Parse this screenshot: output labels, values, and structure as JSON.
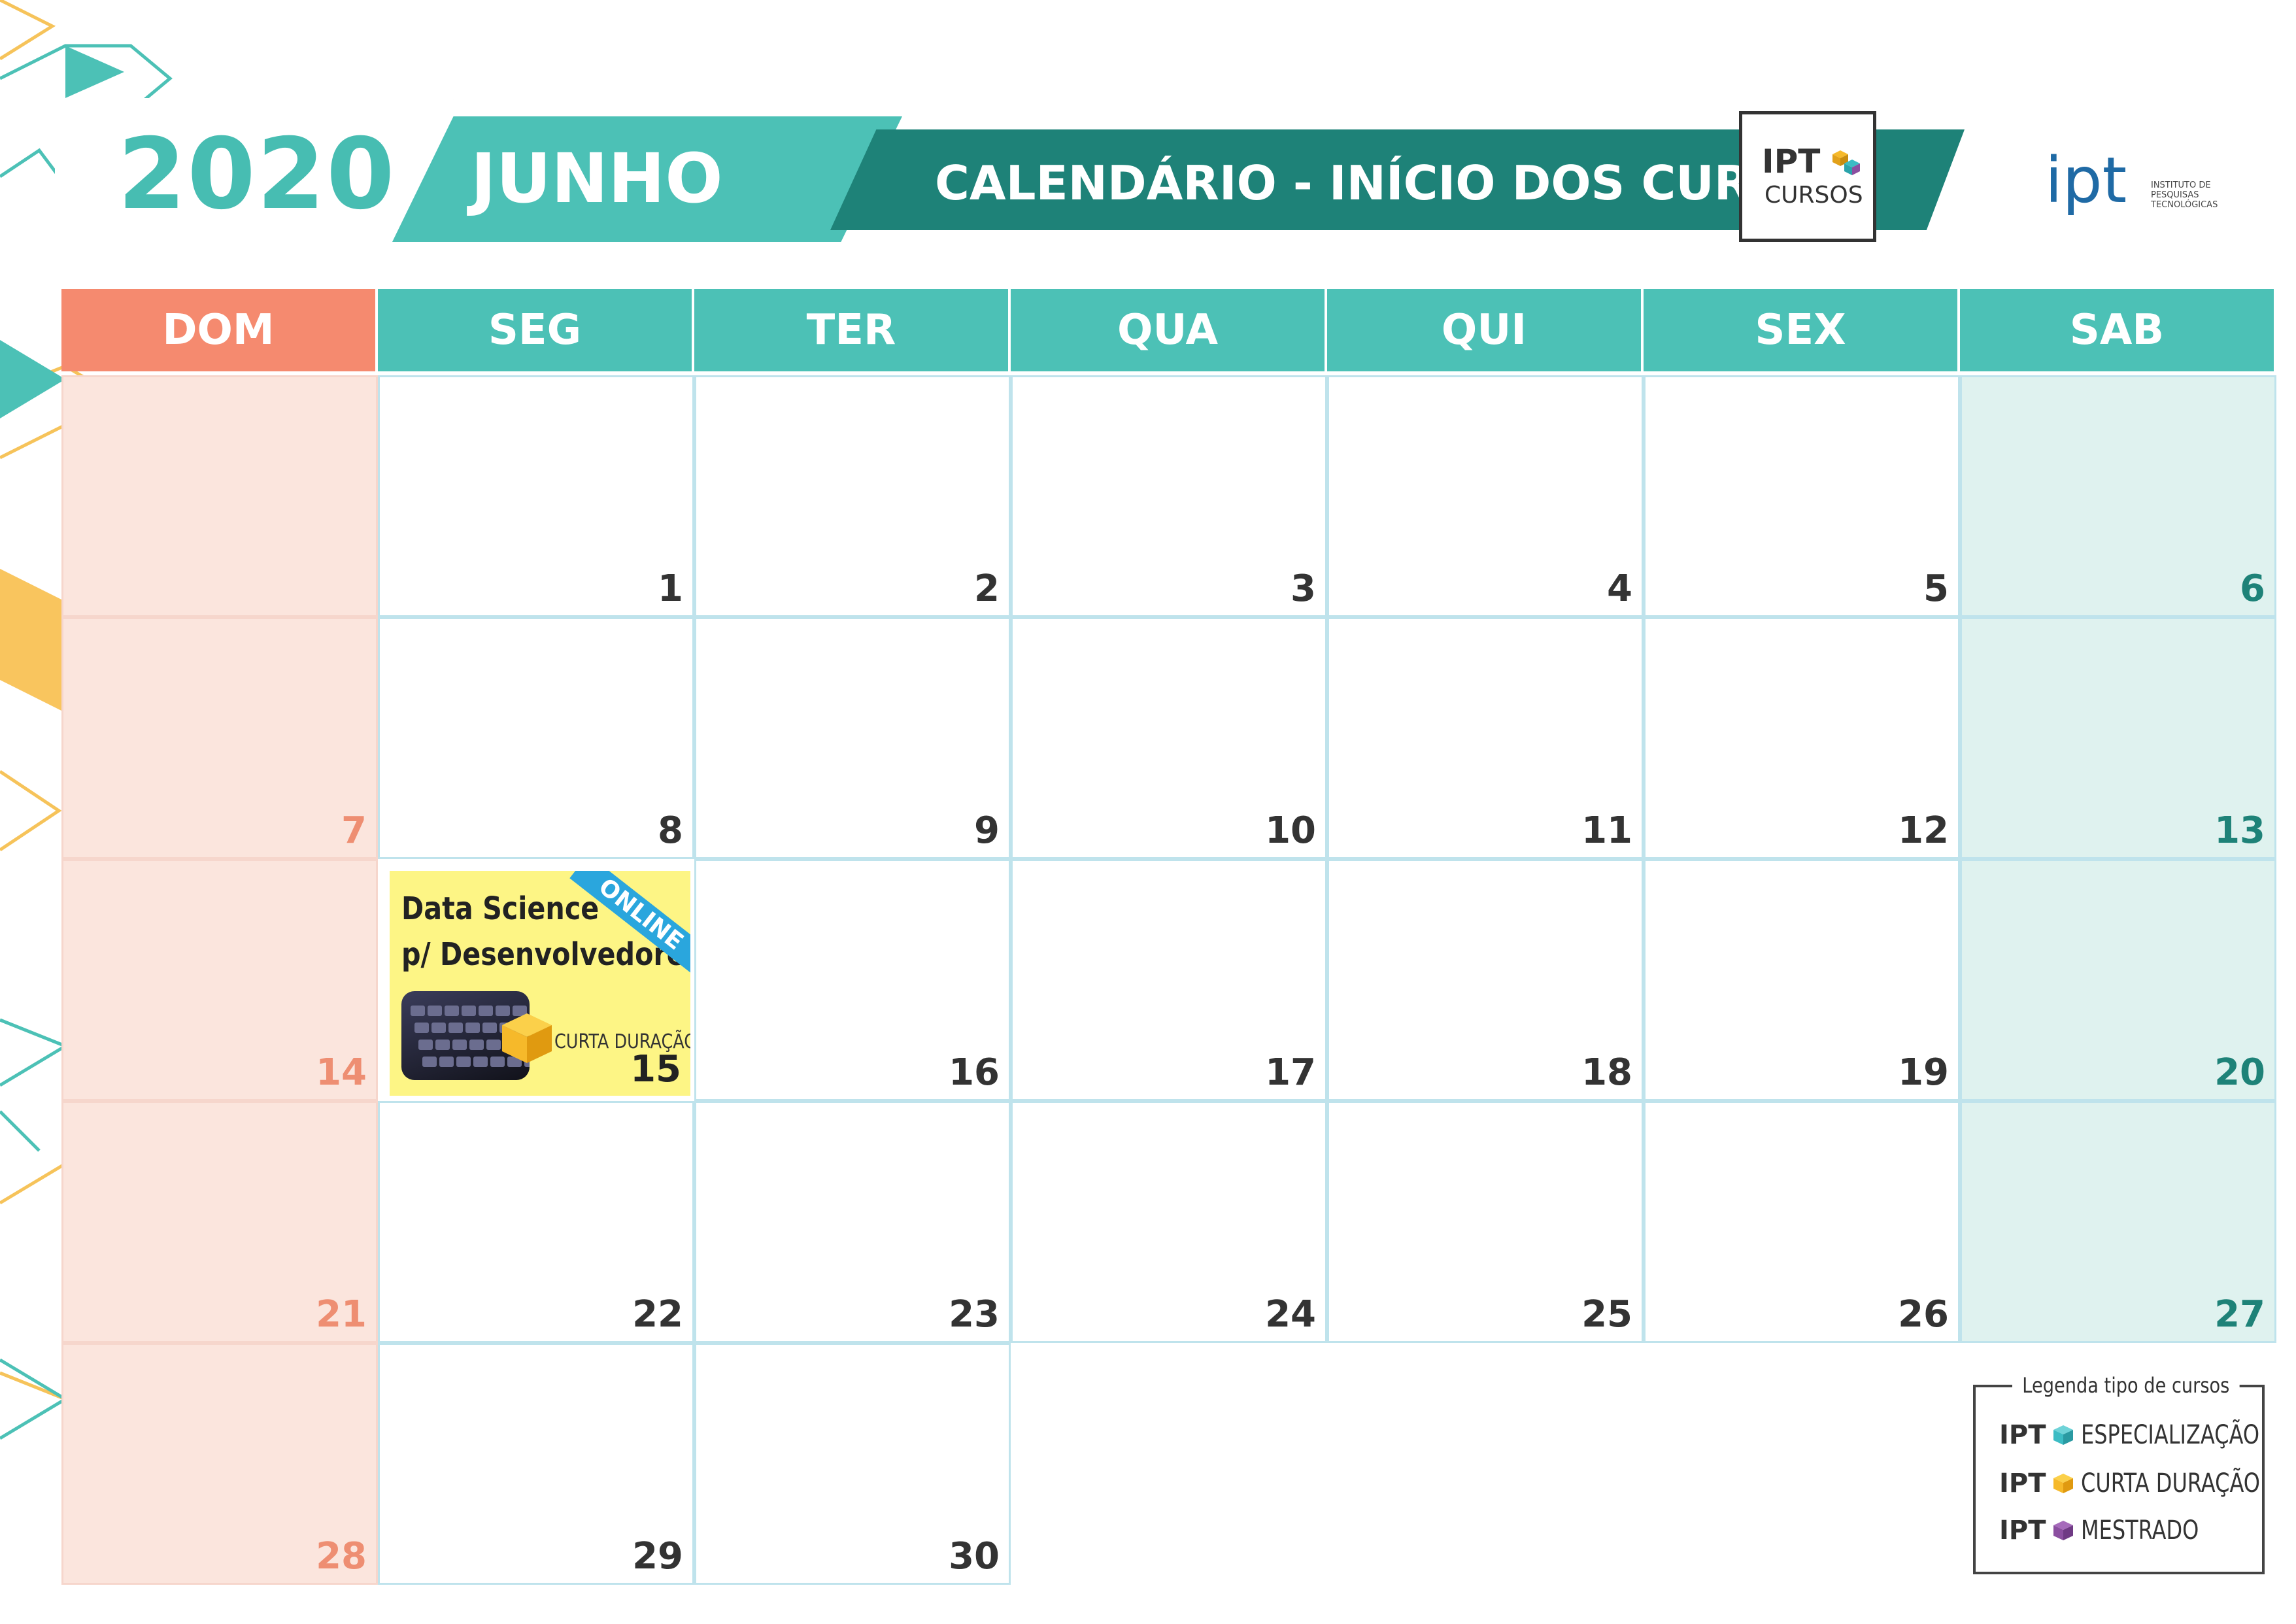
{
  "header": {
    "year": "2020",
    "month": "JUNHO",
    "title": "CALENDÁRIO - INÍCIO DOS CURSOS",
    "ipt_cursos_logo": {
      "line1": "IPT",
      "line2": "CURSOS"
    },
    "ipt_logo": {
      "wordmark": "ipt",
      "subtitle_lines": [
        "INSTITUTO DE",
        "PESQUISAS",
        "TECNOLÓGICAS"
      ]
    }
  },
  "weekdays": [
    "DOM",
    "SEG",
    "TER",
    "QUA",
    "QUI",
    "SEX",
    "SAB"
  ],
  "weeks": [
    [
      "",
      "1",
      "2",
      "3",
      "4",
      "5",
      "6"
    ],
    [
      "7",
      "8",
      "9",
      "10",
      "11",
      "12",
      "13"
    ],
    [
      "14",
      "15",
      "16",
      "17",
      "18",
      "19",
      "20"
    ],
    [
      "21",
      "22",
      "23",
      "24",
      "25",
      "26",
      "27"
    ],
    [
      "28",
      "29",
      "30",
      "",
      "",
      "",
      ""
    ]
  ],
  "event": {
    "day": "15",
    "title_line1": "Data Science",
    "title_line2": "p/ Desenvolvedores",
    "ribbon": "ONLINE",
    "type": "CURTA DURAÇÃO",
    "type_icon": "yellow-cube-icon"
  },
  "legend": {
    "title": "Legenda tipo de cursos",
    "items": [
      {
        "prefix": "IPT",
        "label": "ESPECIALIZAÇÃO",
        "color": "#3cbcc4"
      },
      {
        "prefix": "IPT",
        "label": "CURTA DURAÇÃO",
        "color": "#f6b92a"
      },
      {
        "prefix": "IPT",
        "label": "MESTRADO",
        "color": "#8b4fa0"
      }
    ]
  },
  "colors": {
    "teal": "#4cc1b6",
    "dark_teal": "#1e8278",
    "sunday_header": "#f58a6f",
    "sunday_bg": "#fbe5dd",
    "saturday_bg": "#dff2ef",
    "event_bg": "#fdf585"
  }
}
